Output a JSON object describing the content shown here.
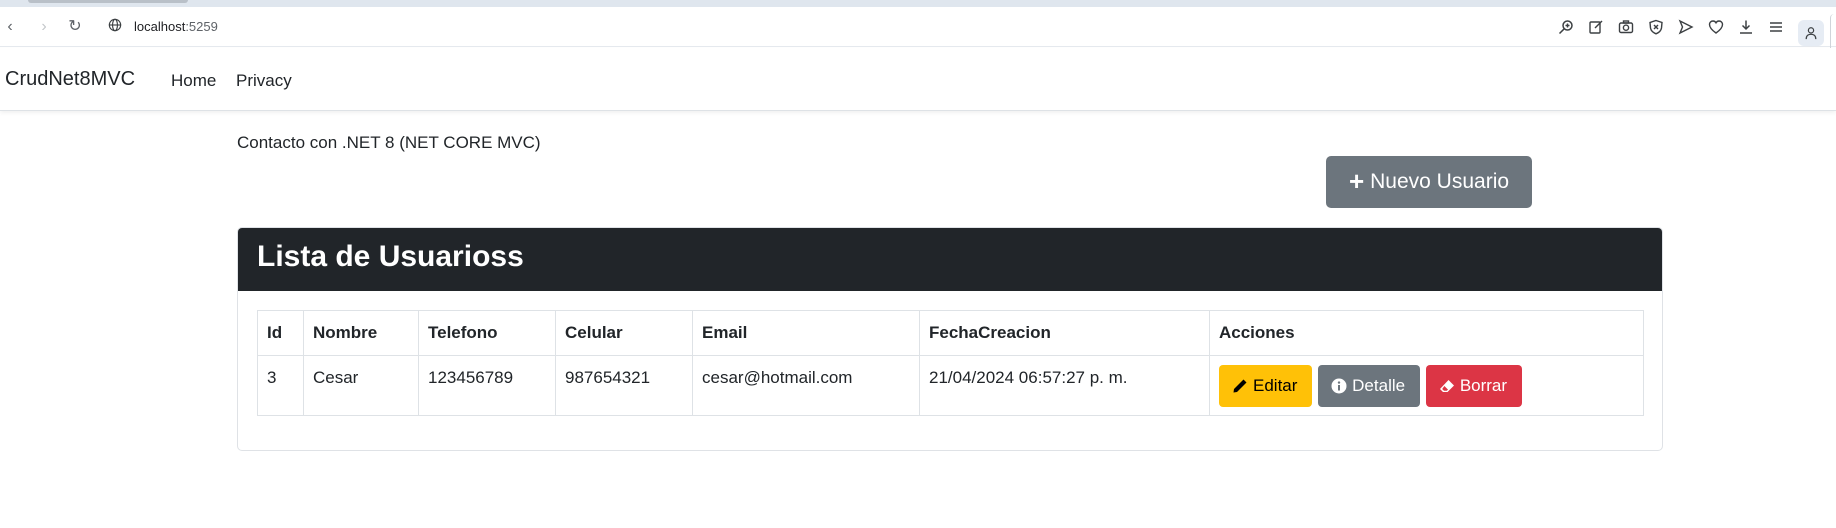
{
  "browser": {
    "url_host": "localhost",
    "url_port": ":5259"
  },
  "navbar": {
    "brand": "CrudNet8MVC",
    "links": [
      {
        "label": "Home"
      },
      {
        "label": "Privacy"
      }
    ]
  },
  "page": {
    "subtitle": "Contacto con .NET 8 (NET CORE MVC)",
    "new_user_label": "Nuevo Usuario",
    "card_title": "Lista de Usuarioss"
  },
  "table": {
    "headers": [
      "Id",
      "Nombre",
      "Telefono",
      "Celular",
      "Email",
      "FechaCreacion",
      "Acciones"
    ],
    "rows": [
      {
        "id": "3",
        "nombre": "Cesar",
        "telefono": "123456789",
        "celular": "987654321",
        "email": "cesar@hotmail.com",
        "fecha": "21/04/2024 06:57:27 p. m."
      }
    ],
    "actions": {
      "edit": "Editar",
      "detail": "Detalle",
      "delete": "Borrar"
    }
  },
  "colors": {
    "header_bg": "#212529",
    "secondary": "#6c757d",
    "warning": "#ffc107",
    "danger": "#dc3545"
  }
}
